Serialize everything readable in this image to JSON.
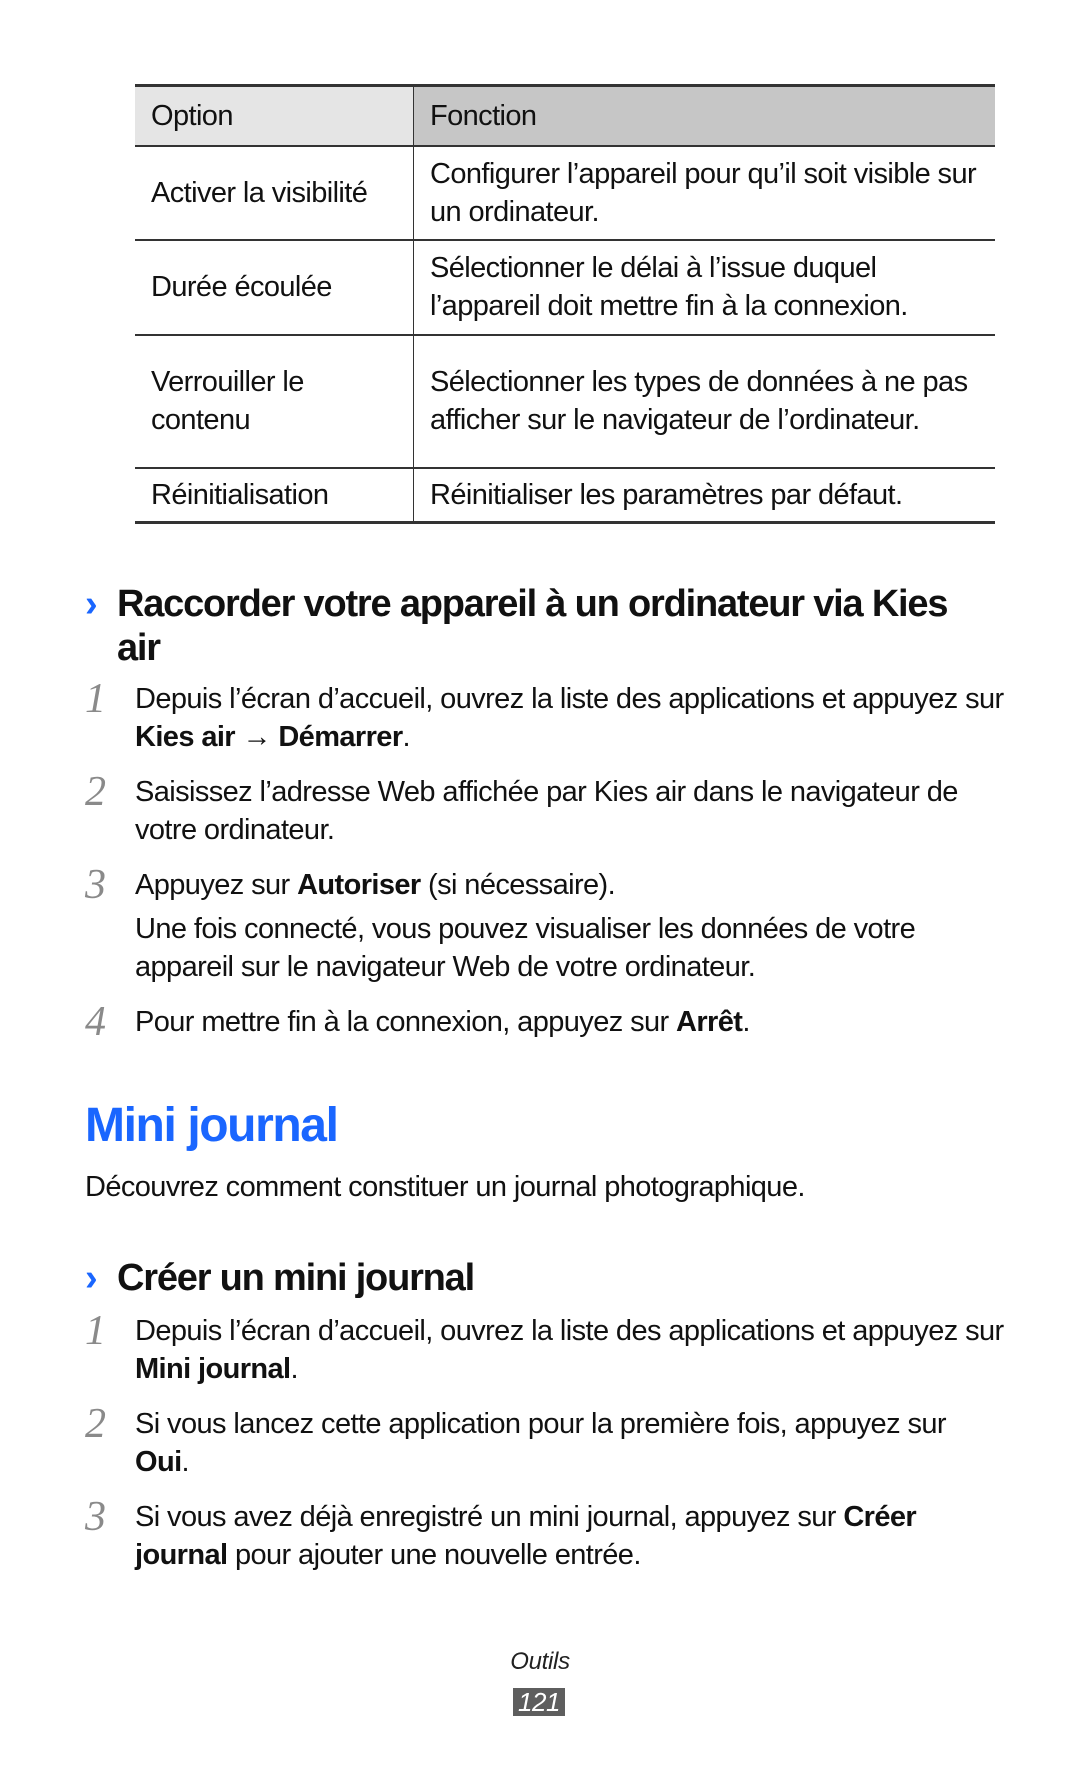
{
  "table": {
    "headers": {
      "option": "Option",
      "fonction": "Fonction"
    },
    "rows": [
      {
        "option": "Activer la visibilité",
        "fonction": "Configurer l’appareil pour qu’il soit visible sur un ordinateur."
      },
      {
        "option": "Durée écoulée",
        "fonction": "Sélectionner le délai à l’issue duquel l’appareil doit mettre fin à la connexion."
      },
      {
        "option": "Verrouiller le contenu",
        "fonction": "Sélectionner les types de données à ne pas afficher sur le navigateur de l’ordinateur."
      },
      {
        "option": "Réinitialisation",
        "fonction": "Réinitialiser les paramètres par défaut."
      }
    ]
  },
  "section_kies": {
    "chevron": "›",
    "heading_line1": "Raccorder votre appareil à un ordinateur via Kies",
    "heading_line2": "air",
    "steps": [
      {
        "num": "1",
        "pre": "Depuis l’écran d’accueil, ouvrez la liste des applications et appuyez sur ",
        "b1": "Kies air",
        "mid": " → ",
        "b2": "Démarrer",
        "post": "."
      },
      {
        "num": "2",
        "text": "Saisissez l’adresse Web affichée par Kies air dans le navigateur de votre ordinateur."
      },
      {
        "num": "3",
        "pre": "Appuyez sur ",
        "b1": "Autoriser",
        "post": " (si nécessaire).",
        "note": "Une fois connecté, vous pouvez visualiser les données de votre appareil sur le navigateur Web de votre ordinateur."
      },
      {
        "num": "4",
        "pre": "Pour mettre fin à la connexion, appuyez sur ",
        "b1": "Arrêt",
        "post": "."
      }
    ]
  },
  "mini_journal": {
    "title": "Mini journal",
    "intro": "Découvrez comment constituer un journal photographique.",
    "subsection": {
      "chevron": "›",
      "heading": "Créer un mini journal",
      "steps": [
        {
          "num": "1",
          "pre": "Depuis l’écran d’accueil, ouvrez la liste des applications et appuyez sur ",
          "b1": "Mini journal",
          "post": "."
        },
        {
          "num": "2",
          "pre": "Si vous lancez cette application pour la première fois, appuyez sur ",
          "b1": "Oui",
          "post": "."
        },
        {
          "num": "3",
          "pre": "Si vous avez déjà enregistré un mini journal, appuyez sur ",
          "b1": "Créer journal",
          "post": " pour ajouter une nouvelle entrée."
        }
      ]
    }
  },
  "footer": {
    "section": "Outils",
    "page": "121"
  },
  "colors": {
    "accent_blue": "#1a66ff",
    "header_light": "#e5e5e5",
    "header_dark": "#c6c6c6",
    "page_badge": "#5e5e5e",
    "step_number": "#8a8a8a"
  }
}
